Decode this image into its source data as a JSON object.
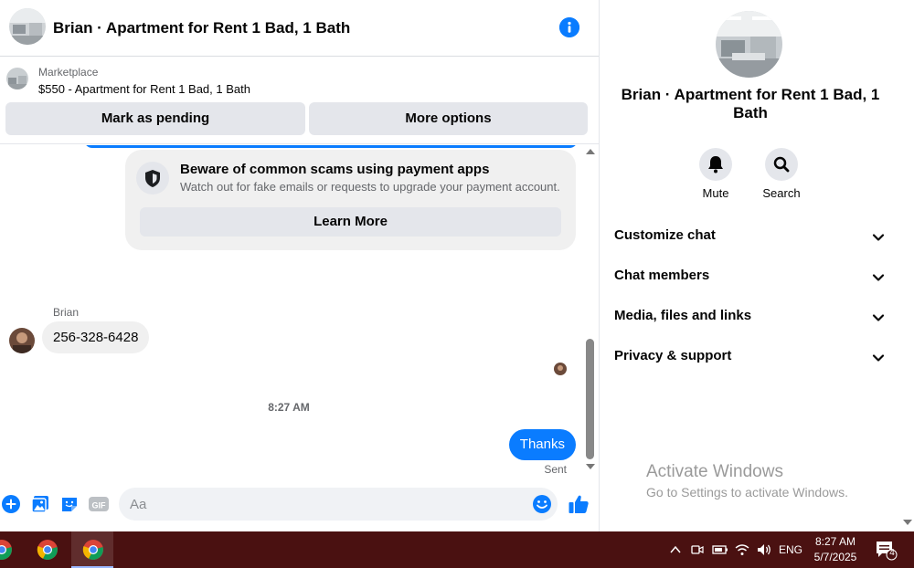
{
  "chat": {
    "title": "Brian · Apartment for Rent 1 Bad, 1 Bath"
  },
  "marketplace": {
    "label": "Marketplace",
    "item": "$550 - Apartment for Rent 1 Bad, 1 Bath",
    "pending_label": "Mark as pending",
    "more_label": "More options"
  },
  "scam_notice": {
    "title": "Beware of common scams using payment apps",
    "subtitle": "Watch out for fake emails or requests to upgrade your payment account.",
    "button": "Learn More"
  },
  "messages": {
    "sender_name": "Brian",
    "incoming_text": "256-328-6428",
    "timestamp": "8:27 AM",
    "outgoing_text": "Thanks",
    "status": "Sent"
  },
  "composer": {
    "placeholder": "Aa"
  },
  "sidebar": {
    "title": "Brian · Apartment for Rent 1 Bad, 1 Bath",
    "actions": [
      {
        "label": "Mute",
        "icon": "bell-icon"
      },
      {
        "label": "Search",
        "icon": "search-icon"
      }
    ],
    "sections": [
      {
        "label": "Customize chat"
      },
      {
        "label": "Chat members"
      },
      {
        "label": "Media, files and links"
      },
      {
        "label": "Privacy & support"
      }
    ]
  },
  "watermark": {
    "line1": "Activate Windows",
    "line2": "Go to Settings to activate Windows."
  },
  "taskbar": {
    "language": "ENG",
    "time": "8:27 AM",
    "date": "5/7/2025",
    "notification_count": "4"
  },
  "colors": {
    "accent": "#0a7cff",
    "bubble_gray": "#f0f0f0",
    "taskbar": "#4a1111"
  }
}
